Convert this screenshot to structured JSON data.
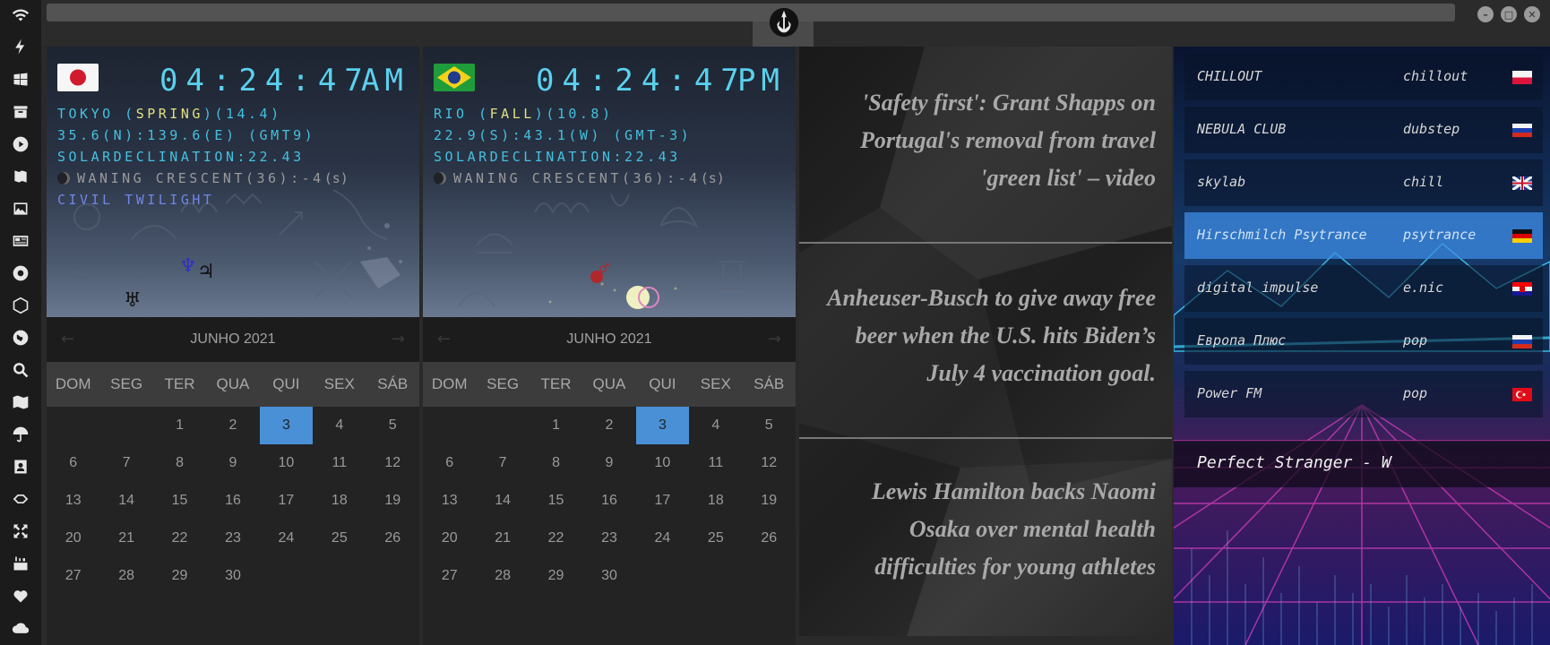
{
  "sidebar": {
    "icons": [
      "wifi-icon",
      "flash-icon",
      "windows-icon",
      "archive-icon",
      "play-icon",
      "map-book-icon",
      "image-icon",
      "news-icon",
      "aperture-icon",
      "hexagon-icon",
      "globe-icon",
      "search-icon",
      "map-icon",
      "umbrella-icon",
      "contact-icon",
      "tag-icon",
      "fullscreen-icon",
      "youtube-icon",
      "heart-icon",
      "cloud-icon"
    ]
  },
  "clocks": [
    {
      "flag": "japan",
      "time": "04:24:47",
      "ampm": "AM",
      "city": "TOKYO",
      "season": "SPRING",
      "temp": "(14.4)",
      "coords": "35.6(N):139.6(E) (GMT9)",
      "solar": "SOLARDECLINATION:22.43",
      "moon": "WANING CRESCENT(36):-4",
      "moon_suffix": "(s)",
      "twilight": "CIVIL TWILIGHT"
    },
    {
      "flag": "brazil",
      "time": "04:24:47",
      "ampm": "PM",
      "city": "RIO",
      "season": "FALL",
      "temp": "(10.8)",
      "coords": "22.9(S):43.1(W) (GMT-3)",
      "solar": "SOLARDECLINATION:22.43",
      "moon": "WANING CRESCENT(36):-4",
      "moon_suffix": "(s)",
      "twilight": ""
    }
  ],
  "calendar": {
    "month": "JUNHO 2021",
    "prev": "←",
    "next": "→",
    "weekdays": [
      "DOM",
      "SEG",
      "TER",
      "QUA",
      "QUI",
      "SEX",
      "SÁB"
    ],
    "weeks": [
      [
        "",
        "",
        "1",
        "2",
        "3",
        "4",
        "5"
      ],
      [
        "6",
        "7",
        "8",
        "9",
        "10",
        "11",
        "12"
      ],
      [
        "13",
        "14",
        "15",
        "16",
        "17",
        "18",
        "19"
      ],
      [
        "20",
        "21",
        "22",
        "23",
        "24",
        "25",
        "26"
      ],
      [
        "27",
        "28",
        "29",
        "30",
        "",
        "",
        ""
      ]
    ],
    "today": "3"
  },
  "news": [
    "'Safety first': Grant Shapps on Portugal's removal from travel 'green list' – video",
    "Anheuser-Busch to give away free beer when the U.S. hits Biden’s July 4 vaccination goal.",
    "Lewis Hamilton backs Naomi Osaka over mental health difficulties for young athletes"
  ],
  "radio": {
    "stations": [
      {
        "name": "CHILLOUT",
        "genre": "chillout",
        "flag": "poland",
        "active": false
      },
      {
        "name": "NEBULA CLUB",
        "genre": "dubstep",
        "flag": "russia",
        "active": false
      },
      {
        "name": "skylab",
        "genre": "chill",
        "flag": "uk",
        "active": false
      },
      {
        "name": "Hirschmilch Psytrance",
        "genre": "psytrance",
        "flag": "germany",
        "active": true
      },
      {
        "name": "digital impulse",
        "genre": "e.nic",
        "flag": "croatia",
        "active": false
      },
      {
        "name": "Европа Плюс",
        "genre": "pop",
        "flag": "russia",
        "active": false
      },
      {
        "name": "Power FM",
        "genre": "pop",
        "flag": "turkey",
        "active": false
      }
    ],
    "now_playing": "Perfect Stranger - W"
  },
  "colors": {
    "digital": "#5ad1ee",
    "info": "#43c1e0",
    "highlight": "#e0e080",
    "twilight": "#6f86e6",
    "today": "#4a90d6",
    "active_station": "#3c8ce6"
  }
}
